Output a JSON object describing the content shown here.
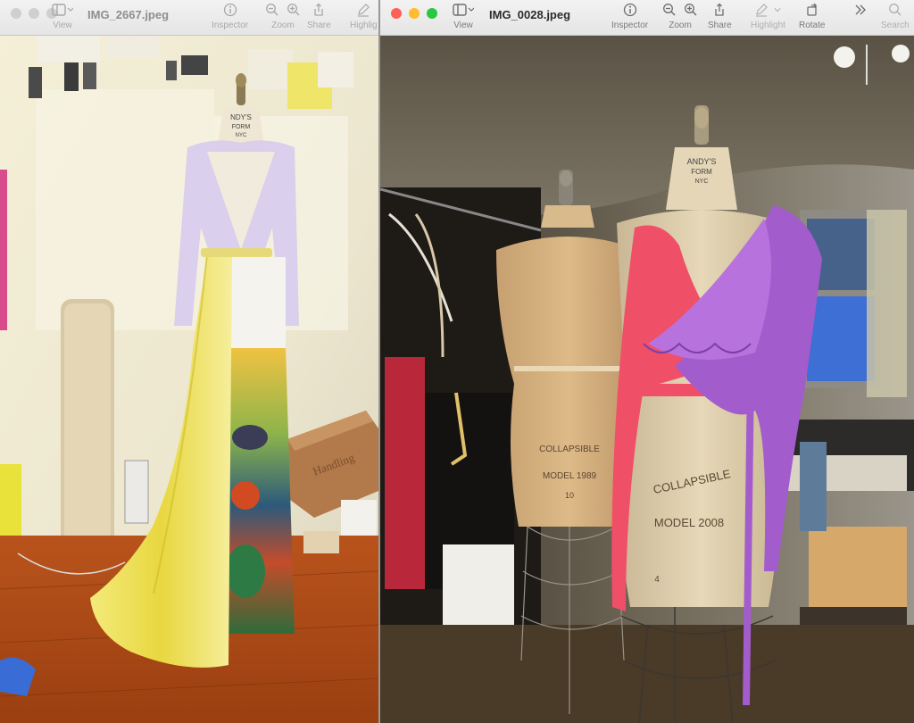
{
  "left_window": {
    "title": "IMG_2667.jpeg",
    "toolbar": {
      "view": "View",
      "inspector": "Inspector",
      "zoom": "Zoom",
      "share": "Share",
      "highlight": "Highlig"
    },
    "photo": {
      "form_label_line1": "NDY'S",
      "form_label_line2": "FORM",
      "form_label_line3": "NYC",
      "box_text": "Handling"
    }
  },
  "right_window": {
    "title": "IMG_0028.jpeg",
    "toolbar": {
      "view": "View",
      "inspector": "Inspector",
      "zoom": "Zoom",
      "share": "Share",
      "highlight": "Highlight",
      "rotate": "Rotate",
      "search": "Search"
    },
    "photo": {
      "back_form_line1": "COLLAPSIBLE",
      "back_form_line2": "MODEL 1989",
      "back_form_size": "10",
      "front_form_top_line1": "ANDY'S",
      "front_form_top_line2": "FORM",
      "front_form_top_line3": "NYC",
      "front_form_line1": "COLLAPSIBLE",
      "front_form_line2": "MODEL 2008",
      "front_form_size": "4"
    }
  },
  "colors": {
    "close": "#fe5f57",
    "minimize": "#febc2e",
    "zoom": "#28c840",
    "inactive_light": "#d0cfcf"
  }
}
